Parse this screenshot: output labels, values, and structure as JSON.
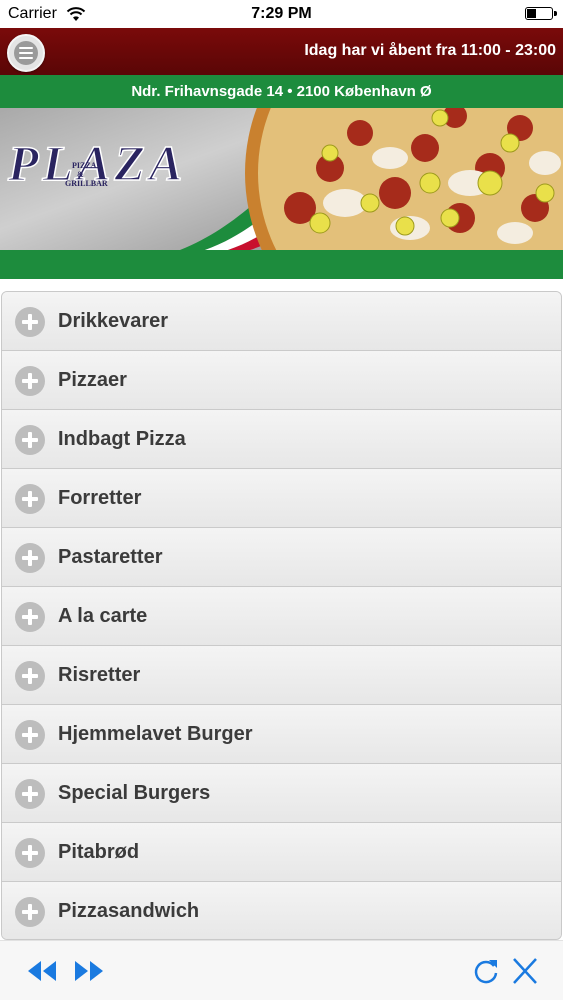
{
  "status_bar": {
    "carrier": "Carrier",
    "time": "7:29 PM",
    "icons": [
      "wifi-icon",
      "battery-icon"
    ]
  },
  "header": {
    "hours": "Idag har vi åbent fra 11:00 - 23:00",
    "colors": {
      "header_red": "#6a0808",
      "brand_green": "#1d8c3d"
    }
  },
  "address": "Ndr. Frihavnsgade 14 • 2100 København Ø",
  "banner": {
    "logo_text": "PLAZA",
    "logo_subtext_1": "PIZZA",
    "logo_subtext_2": "&",
    "logo_subtext_3": "GRILLBAR"
  },
  "menu": {
    "items": [
      {
        "label": "Drikkevarer"
      },
      {
        "label": "Pizzaer"
      },
      {
        "label": "Indbagt Pizza"
      },
      {
        "label": "Forretter"
      },
      {
        "label": "Pastaretter"
      },
      {
        "label": "A la carte"
      },
      {
        "label": "Risretter"
      },
      {
        "label": "Hjemmelavet Burger"
      },
      {
        "label": "Special Burgers"
      },
      {
        "label": "Pitabrød"
      },
      {
        "label": "Pizzasandwich"
      }
    ]
  },
  "toolbar": {
    "icons": [
      "rewind-icon",
      "fast-forward-icon",
      "refresh-icon",
      "close-icon"
    ],
    "accent": "#1a7ae0"
  }
}
